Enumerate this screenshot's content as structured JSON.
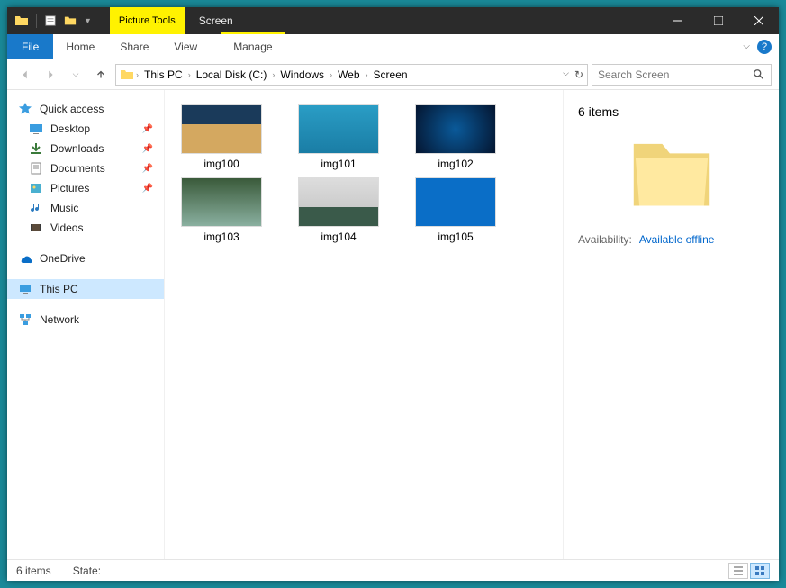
{
  "window": {
    "context_tab_title": "Picture Tools",
    "title": "Screen"
  },
  "ribbon": {
    "file": "File",
    "tabs": [
      "Home",
      "Share",
      "View"
    ],
    "context_tab": "Manage"
  },
  "breadcrumb": [
    "This PC",
    "Local Disk (C:)",
    "Windows",
    "Web",
    "Screen"
  ],
  "search": {
    "placeholder": "Search Screen"
  },
  "navpane": {
    "quick_access": "Quick access",
    "items": [
      {
        "label": "Desktop",
        "pinned": true
      },
      {
        "label": "Downloads",
        "pinned": true
      },
      {
        "label": "Documents",
        "pinned": true
      },
      {
        "label": "Pictures",
        "pinned": true
      },
      {
        "label": "Music",
        "pinned": false
      },
      {
        "label": "Videos",
        "pinned": false
      }
    ],
    "onedrive": "OneDrive",
    "this_pc": "This PC",
    "network": "Network"
  },
  "files": [
    {
      "name": "img100"
    },
    {
      "name": "img101"
    },
    {
      "name": "img102"
    },
    {
      "name": "img103"
    },
    {
      "name": "img104"
    },
    {
      "name": "img105"
    }
  ],
  "details": {
    "count": "6 items",
    "availability_label": "Availability:",
    "availability_value": "Available offline"
  },
  "statusbar": {
    "count": "6 items",
    "state_label": "State:"
  }
}
